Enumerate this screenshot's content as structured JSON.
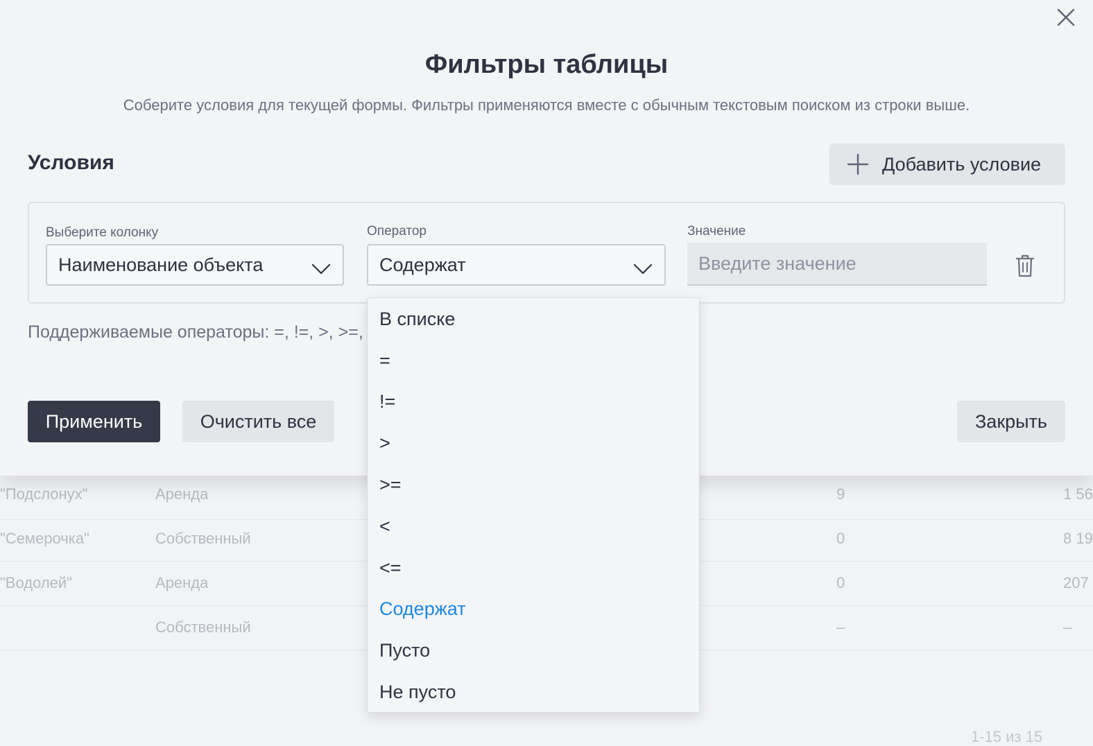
{
  "background_table": {
    "rows": [
      {
        "name": "\"Подслонух\"",
        "type": "Аренда",
        "count": "9",
        "amount": "1 56"
      },
      {
        "name": "\"Семерочка\"",
        "type": "Собственный",
        "count": "0",
        "amount": "8 19"
      },
      {
        "name": "\"Водолей\"",
        "type": "Аренда",
        "count": "0",
        "amount": "207"
      },
      {
        "name": "",
        "type": "Собственный",
        "count": "–",
        "amount": "–"
      }
    ],
    "pagination": "1-15 из 15"
  },
  "modal": {
    "title": "Фильтры таблицы",
    "subtitle": "Соберите условия для текущей формы. Фильтры применяются вместе с обычным текстовым поиском из строки выше.",
    "section_title": "Условия",
    "add_condition_label": "Добавить условие",
    "condition": {
      "column_label": "Выберите колонку",
      "column_value": "Наименование объекта",
      "operator_label": "Оператор",
      "operator_value": "Содержат",
      "value_label": "Значение",
      "value_placeholder": "Введите значение",
      "value": ""
    },
    "ops_hint": "Поддерживаемые операторы: =, !=, >, >=,",
    "apply_label": "Применить",
    "clear_label": "Очистить все",
    "close_label": "Закрыть"
  },
  "operator_dropdown": {
    "options": [
      "В списке",
      "=",
      "!=",
      ">",
      ">=",
      "<",
      "<=",
      "Содержат",
      "Пусто",
      "Не пусто"
    ],
    "selected": "Содержат",
    "selected_color": "#1e88e5"
  },
  "colors": {
    "primary_button": "#363948",
    "accent": "#1e88e5"
  }
}
